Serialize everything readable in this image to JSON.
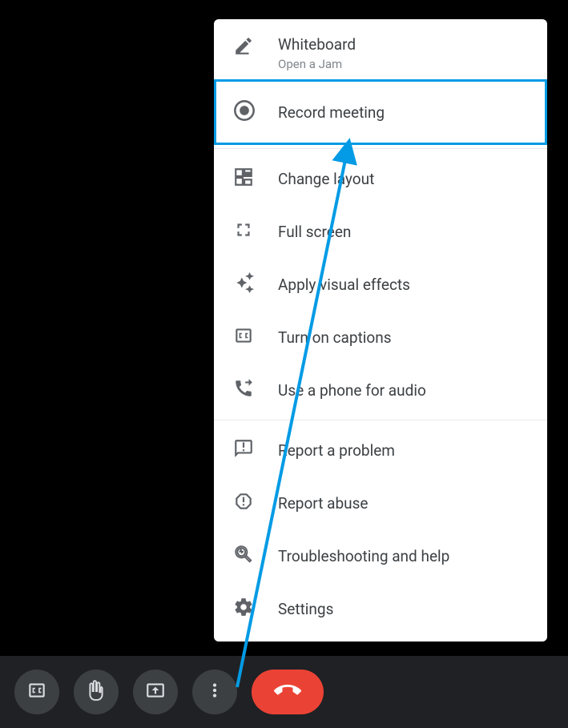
{
  "menu": {
    "whiteboard": {
      "label": "Whiteboard",
      "sublabel": "Open a Jam"
    },
    "record": {
      "label": "Record meeting"
    },
    "change_layout": {
      "label": "Change layout"
    },
    "full_screen": {
      "label": "Full screen"
    },
    "visual_effects": {
      "label": "Apply visual effects"
    },
    "captions": {
      "label": "Turn on captions"
    },
    "phone_audio": {
      "label": "Use a phone for audio"
    },
    "report_problem": {
      "label": "Report a problem"
    },
    "report_abuse": {
      "label": "Report abuse"
    },
    "troubleshooting": {
      "label": "Troubleshooting and help"
    },
    "settings": {
      "label": "Settings"
    }
  },
  "annotation": {
    "highlight_color": "#039be5"
  }
}
